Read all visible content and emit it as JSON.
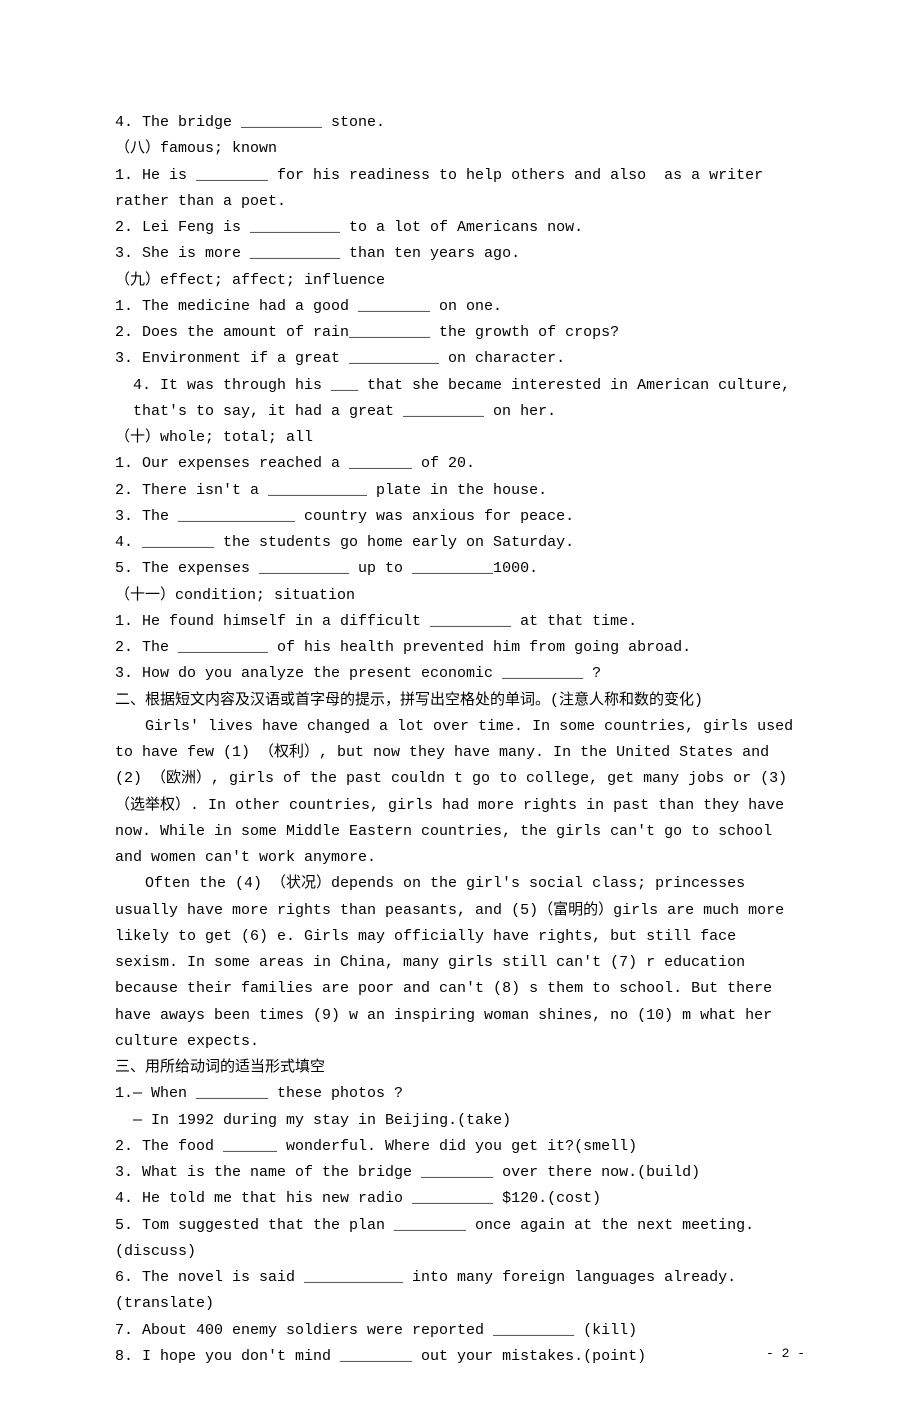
{
  "lines": {
    "l1": "4. The bridge _________ stone.",
    "l2": "（八）famous; known",
    "l3": "1. He is ________ for his readiness to help others and also  as a writer rather than a poet.",
    "l4": "2. Lei Feng is __________ to a lot of Americans now.",
    "l5": "3. She is more __________ than ten years ago.",
    "l6": "（九）effect; affect; influence",
    "l7": "1. The medicine had a good ________ on one.",
    "l8": "2. Does the amount of rain_________ the growth of crops?",
    "l9": "3. Environment if a great __________ on character.",
    "l10": "4. It was through his ___ that she became interested in American culture, that's to say, it had a great _________ on her.",
    "l11": "（十）whole; total; all",
    "l12": "1. Our expenses reached a _______ of 20.",
    "l13": "2. There isn't a ___________ plate in the house.",
    "l14": "3. The _____________ country was anxious for peace.",
    "l15": "4. ________ the students go home early on Saturday.",
    "l16": "5. The expenses __________ up to _________1000.",
    "l17": "（十一）condition; situation",
    "l18": "1. He found himself in a difficult _________ at that time.",
    "l19": "2. The __________ of his health prevented him from going abroad.",
    "l20": "3. How do you analyze the present economic _________ ?",
    "l21": "二、根据短文内容及汉语或首字母的提示，拼写出空格处的单词。(注意人称和数的变化)",
    "l22": "Girls' lives have changed a lot over time. In some countries, girls used to have few (1) （权利）, but now they have many. In the United States and (2) （欧洲）, girls of the past couldn t go to college, get many jobs or (3) （选举权）. In other countries, girls had more rights in past than they have now. While in some Middle Eastern countries, the girls can't go to school and women can't work anymore.",
    "l23": "Often the (4) （状况）depends on the girl's social class; princesses usually have more rights than peasants, and (5)（富明的）girls are much more likely to get (6) e. Girls may officially have rights, but still face sexism. In some areas in China, many girls still can't (7) r education because their families are poor and can't (8) s them to school. But there have aways been times (9) w an inspiring woman shines, no (10) m what her culture expects.",
    "l24": "三、用所给动词的适当形式填空",
    "l25": "1.— When ________ these photos ?",
    "l26": "  — In 1992 during my stay in Beijing.(take)",
    "l27": "2. The food ______ wonderful. Where did you get it?(smell)",
    "l28": "3. What is the name of the bridge ________ over there now.(build)",
    "l29": "4. He told me that his new radio _________ $120.(cost)",
    "l30": "5. Tom suggested that the plan ________ once again at the next meeting.(discuss)",
    "l31": "6. The novel is said ___________ into many foreign languages already.(translate)",
    "l32": "7. About 400 enemy soldiers were reported _________ (kill)",
    "l33": "8. I hope you don't mind ________ out your mistakes.(point)"
  },
  "footer": "- 2 -"
}
